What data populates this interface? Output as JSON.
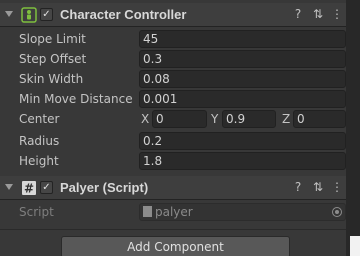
{
  "character_controller": {
    "title": "Character Controller",
    "enabled_mark": "✓",
    "fields": {
      "slope_limit": {
        "label": "Slope Limit",
        "value": "45"
      },
      "step_offset": {
        "label": "Step Offset",
        "value": "0.3"
      },
      "skin_width": {
        "label": "Skin Width",
        "value": "0.08"
      },
      "min_move_distance": {
        "label": "Min Move Distance",
        "value": "0.001"
      },
      "center": {
        "label": "Center",
        "x_label": "X",
        "x": "0",
        "y_label": "Y",
        "y": "0.9",
        "z_label": "Z",
        "z": "0"
      },
      "radius": {
        "label": "Radius",
        "value": "0.2"
      },
      "height": {
        "label": "Height",
        "value": "1.8"
      }
    }
  },
  "script_component": {
    "title": "Palyer (Script)",
    "enabled_mark": "✓",
    "icon_text": "#",
    "script_label": "Script",
    "script_value": "palyer"
  },
  "icons": {
    "help": "?",
    "settings": "⇅",
    "menu": "⋮"
  },
  "add_component_label": "Add Component"
}
